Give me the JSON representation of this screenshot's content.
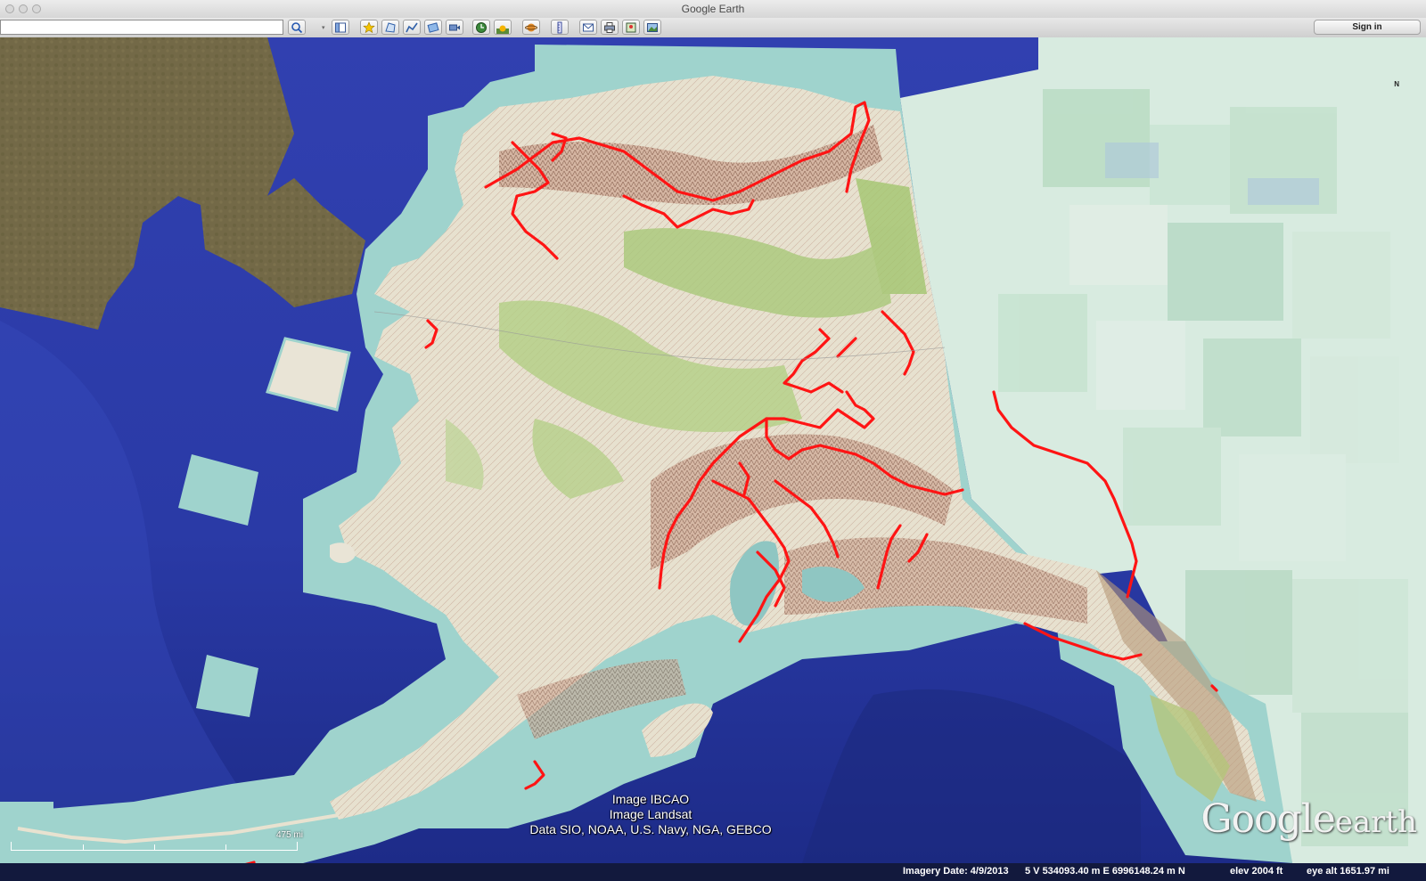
{
  "window": {
    "title": "Google Earth"
  },
  "toolbar": {
    "search_value": "",
    "sign_in_label": "Sign in",
    "buttons": [
      "search-icon",
      "sidebar-icon",
      "placemark-icon",
      "polygon-icon",
      "path-icon",
      "image-overlay-icon",
      "tour-icon",
      "historical-imagery-icon",
      "sunlight-icon",
      "planet-icon",
      "ruler-icon",
      "email-icon",
      "print-icon",
      "maps-icon",
      "photo-icon"
    ]
  },
  "map": {
    "north_label": "N",
    "attribution": [
      "Image IBCAO",
      "Image Landsat",
      "Data SIO, NOAA, U.S. Navy, NGA, GEBCO"
    ],
    "logo_google": "Google",
    "logo_earth": "earth",
    "scale_label": "475 mi",
    "colors": {
      "ocean": "#2b3fa8",
      "track": "#ff1414",
      "land_tan": "#e8e2d0",
      "land_green": "#a8c97a",
      "tile_teal": "#9ad0cc",
      "yukon_green": "#b5dcc4"
    }
  },
  "status": {
    "imagery_date": "Imagery Date: 4/9/2013",
    "coordinates": "5 V 534093.40 m E 6996148.24 m N",
    "elevation": "elev  2004 ft",
    "eye_alt": "eye alt 1651.97 mi"
  }
}
